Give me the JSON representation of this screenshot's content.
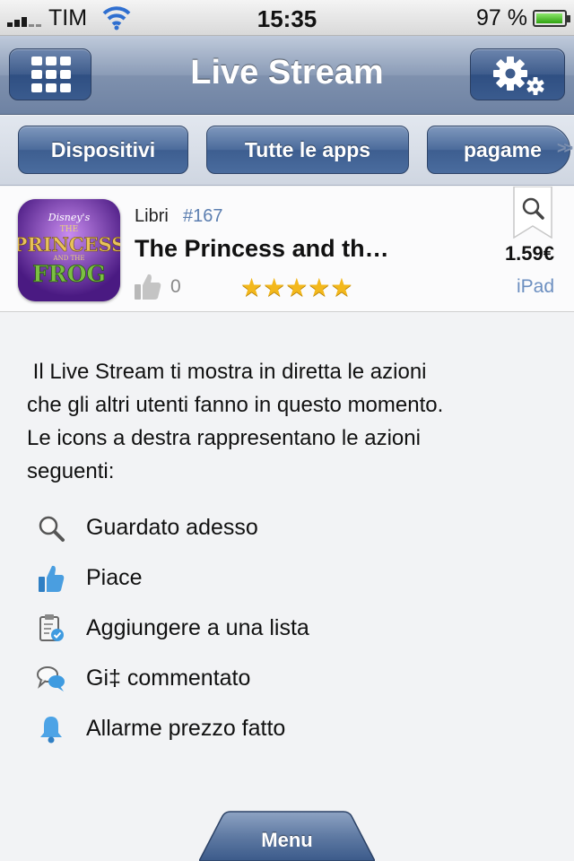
{
  "status_bar": {
    "carrier": "TIM",
    "time": "15:35",
    "battery_percent": "97 %",
    "battery_level": 0.97
  },
  "nav": {
    "title": "Live Stream",
    "left_icon": "grid-icon",
    "right_icon": "gear-icon"
  },
  "filters": [
    {
      "label": "Dispositivi"
    },
    {
      "label": "Tutte le apps"
    },
    {
      "label": "pagame"
    }
  ],
  "filters_more": ">>",
  "app": {
    "category": "Libri",
    "rank": "#167",
    "title": "The Princess and th…",
    "likes": "0",
    "rating": 5,
    "stars": "★★★★★",
    "price": "1.59€",
    "device": "iPad",
    "icon_text": {
      "brand": "Disney's",
      "line1": "THE",
      "line2": "PRINCESS",
      "line3": "AND THE",
      "line4": "FROG"
    }
  },
  "intro": {
    "lines": [
      " Il Live Stream ti mostra in diretta le azioni",
      "che gli altri utenti fanno in questo momento.",
      "Le icons a destra rappresentano le azioni",
      "seguenti:"
    ]
  },
  "legend": [
    {
      "icon": "magnifier-icon",
      "label": "Guardato adesso"
    },
    {
      "icon": "thumbs-up-icon",
      "label": "Piace"
    },
    {
      "icon": "clipboard-check-icon",
      "label": "Aggiungere a una lista"
    },
    {
      "icon": "speech-bubbles-icon",
      "label": "Gi‡ commentato"
    },
    {
      "icon": "bell-icon",
      "label": "Allarme prezzo fatto"
    }
  ],
  "bottom": {
    "menu_label": "Menu"
  },
  "colors": {
    "nav_blue": "#3e5c8c",
    "accent_blue": "#5b7eb0",
    "star": "#f3b81c"
  }
}
